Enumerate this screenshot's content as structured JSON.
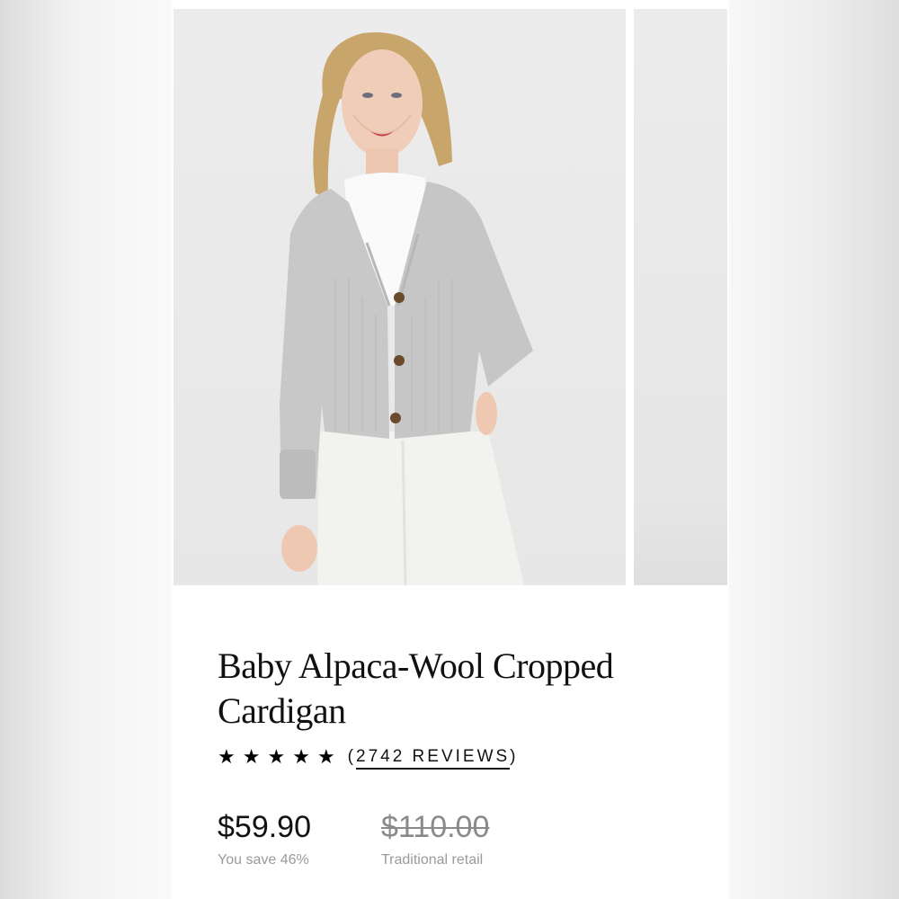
{
  "product": {
    "title": "Baby Alpaca-Wool Cropped Cardigan",
    "rating": {
      "stars": 5,
      "reviews_prefix": "(",
      "reviews_link": "2742 REVIEWS",
      "reviews_suffix": ")"
    },
    "price": {
      "current": "$59.90",
      "savings": "You save 46%",
      "retail": "$110.00",
      "retail_label": "Traditional retail"
    }
  },
  "icons": {
    "star": "star-icon"
  },
  "colors": {
    "sweater": "#c8c8c8",
    "background": "#ffffff",
    "text": "#111111",
    "muted": "#9a9a9a"
  }
}
